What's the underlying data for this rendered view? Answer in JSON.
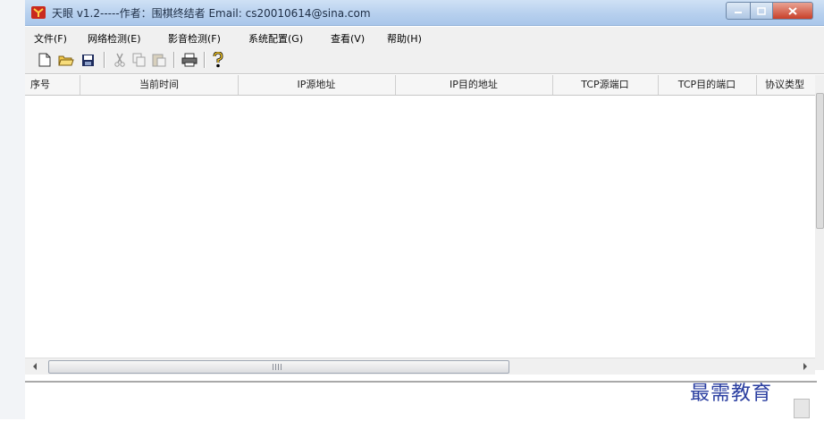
{
  "window": {
    "title": "天眼 v1.2-----作者：围棋终结者  Email: cs20010614@sina.com"
  },
  "menu": [
    {
      "label": "文件(F)"
    },
    {
      "label": "网络检测(E)"
    },
    {
      "label": "影音检测(F)"
    },
    {
      "label": "系统配置(G)"
    },
    {
      "label": "查看(V)"
    },
    {
      "label": "帮助(H)"
    }
  ],
  "toolbar": {
    "icons": [
      "new-file-icon",
      "open-folder-icon",
      "save-icon",
      "cut-icon",
      "copy-icon",
      "paste-icon",
      "print-icon",
      "help-icon"
    ]
  },
  "table": {
    "columns": [
      {
        "label": "序号"
      },
      {
        "label": "当前时间"
      },
      {
        "label": "IP源地址"
      },
      {
        "label": "IP目的地址"
      },
      {
        "label": "TCP源端口"
      },
      {
        "label": "TCP目的端口"
      },
      {
        "label": "协议类型"
      }
    ]
  },
  "watermark": "最需教育",
  "colors": {
    "title_bar": "#b7d0ee",
    "close_button": "#c8402a",
    "watermark": "#2a3ea0"
  }
}
